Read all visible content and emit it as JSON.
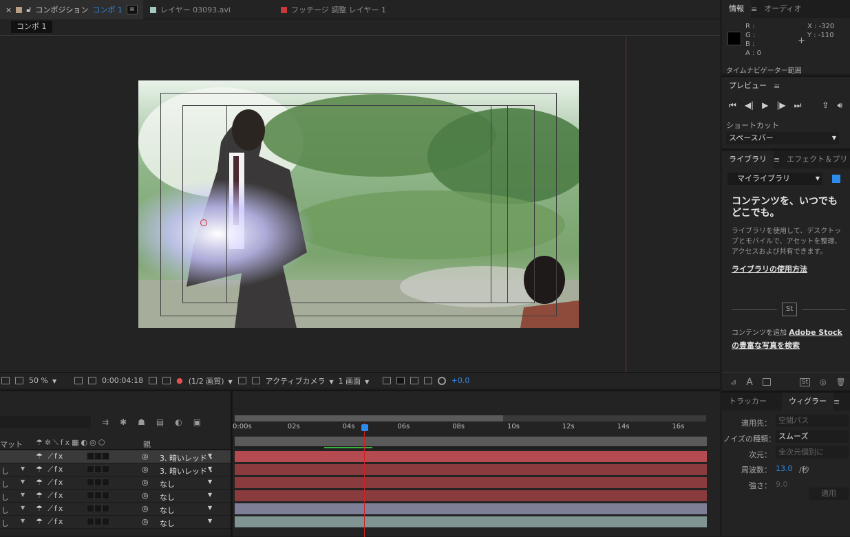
{
  "tabs": [
    {
      "label": "コンポジション",
      "accent": "コンポ 1",
      "color": "#b5a085"
    },
    {
      "label": "レイヤー 03093.avi",
      "color": "#a3c7c0"
    },
    {
      "label": "フッテージ 調整 レイヤー 1",
      "color": "#c83a3a"
    }
  ],
  "comp_chip": "コンポ 1",
  "viewer": {
    "zoom": "50 %",
    "timecode": "0:00:04:18",
    "resolution": "(1/2 画質)",
    "camera": "アクティブカメラ",
    "views": "1 画面",
    "exposure": "+0.0"
  },
  "info": {
    "title": "情報",
    "tab2": "オーディオ",
    "r": "R :",
    "g": "G :",
    "b": "B :",
    "a": "A : 0",
    "x": "X : -320",
    "y": "Y : -110",
    "nav": "タイムナビゲーター範囲"
  },
  "preview": {
    "title": "プレビュー",
    "shortcut_label": "ショートカット",
    "shortcut_value": "スペースバー"
  },
  "library": {
    "tab1": "ライブラリ",
    "tab2": "エフェクト＆プリ",
    "select": "マイライブラリ",
    "heading": "コンテンツを、いつでもどこでも。",
    "body": "ライブラリを使用して、デスクトップとモバイルで、アセットを整理、アクセスおよび共有できます。",
    "link": "ライブラリの使用方法",
    "stock_pre": "コンテンツを追加",
    "stock_brand": "Adobe Stock",
    "stock_link": "の豊富な写真を検索",
    "st": "St"
  },
  "wiggler": {
    "tab1": "トラッカー",
    "tab2": "ウィグラー",
    "apply_to_label": "適用先：",
    "apply_to_value": "空間パス",
    "noise_label": "ノイズの種類：",
    "noise_value": "スムーズ",
    "dim_label": "次元：",
    "dim_value": "全次元個別に",
    "freq_label": "周波数：",
    "freq_value": "13.0",
    "freq_unit": "/秒",
    "mag_label": "強さ：",
    "mag_value": "9.0",
    "apply": "適用"
  },
  "timeline": {
    "col_matte": "マット",
    "col_parent": "親",
    "ticks": [
      "0:00s",
      "02s",
      "04s",
      "06s",
      "08s",
      "10s",
      "12s",
      "14s",
      "16s"
    ],
    "rows": [
      {
        "mode": "",
        "parent": "3. 暗いレッド・",
        "bar": "#b54a50"
      },
      {
        "mode": "し",
        "parent": "3. 暗いレッド・",
        "bar": "#8a3b3e"
      },
      {
        "mode": "し",
        "parent": "なし",
        "bar": "#8a3b3e"
      },
      {
        "mode": "し",
        "parent": "なし",
        "bar": "#8a3b3e"
      },
      {
        "mode": "し",
        "parent": "なし",
        "bar": "#7f7e97"
      },
      {
        "mode": "し",
        "parent": "なし",
        "bar": "#7f9493"
      }
    ]
  },
  "colors": {
    "accent": "#2d8ceb",
    "playhead": "#d02020"
  }
}
